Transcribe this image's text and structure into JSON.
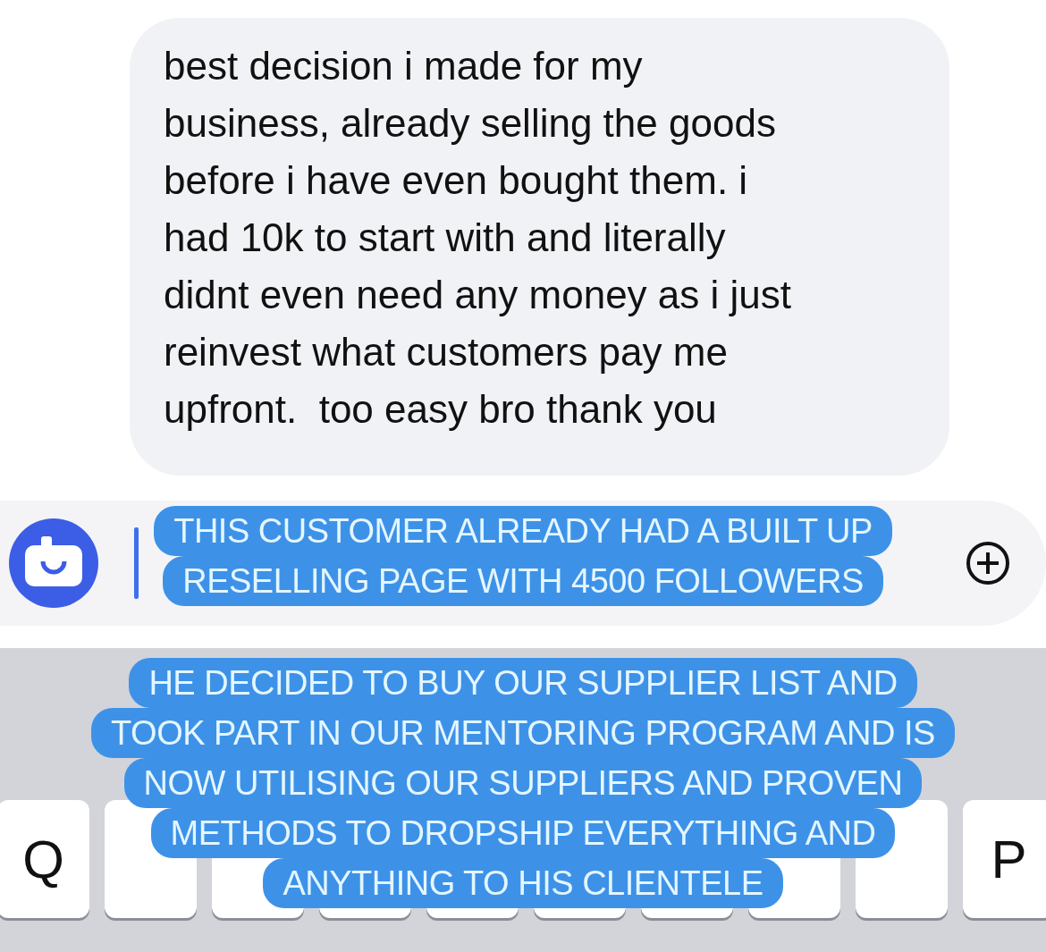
{
  "message": {
    "lines": [
      "best decision i made for my",
      "business, already selling the goods",
      "before i have even bought them. i",
      "had 10k to start with and literally",
      "didnt even need any money as i just",
      "reinvest what customers pay me",
      "upfront.  too easy bro thank you"
    ]
  },
  "captions": [
    {
      "lines": [
        "THIS CUSTOMER ALREADY HAD A BUILT UP",
        "RESELLING PAGE WITH 4500 FOLLOWERS"
      ]
    },
    {
      "lines": [
        "HE DECIDED TO BUY OUR SUPPLIER LIST AND",
        "TOOK PART IN OUR MENTORING PROGRAM AND IS",
        "NOW UTILISING OUR SUPPLIERS AND PROVEN",
        "METHODS TO DROPSHIP EVERYTHING AND",
        "ANYTHING TO HIS CLIENTELE"
      ]
    }
  ],
  "keyboard": {
    "keys_left": [
      "Q"
    ],
    "keys_right": [
      "P"
    ]
  }
}
